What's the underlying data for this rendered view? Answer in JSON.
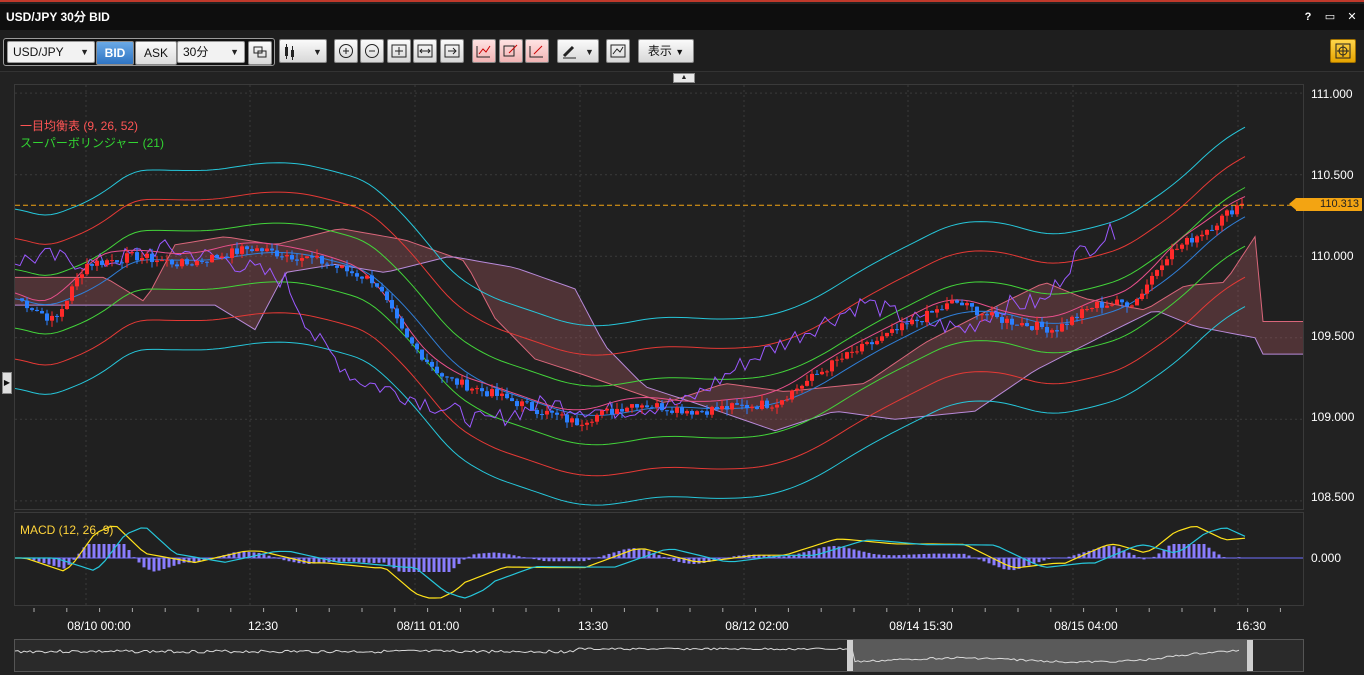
{
  "window": {
    "title": "USD/JPY 30分 BID",
    "controls": [
      "?",
      "▭",
      "✕"
    ]
  },
  "toolbar": {
    "symbol": "USD/JPY",
    "bid_label": "BID",
    "ask_label": "ASK",
    "timeframe": "30分",
    "display_label": "表示"
  },
  "chart": {
    "indicator_legend": [
      {
        "label": "一目均衡表 (9, 26, 52)",
        "color": "#ff5555"
      },
      {
        "label": "スーパーボリンジャー (21)",
        "color": "#32d432"
      }
    ],
    "y_ticks": [
      "111.000",
      "110.500",
      "110.000",
      "109.500",
      "109.000",
      "108.500"
    ],
    "current_price": "110.313",
    "macd_legend": "MACD (12, 26, 9)",
    "macd_zero": "0.000",
    "x_labels": [
      "08/10 00:00",
      "12:30",
      "08/11 01:00",
      "13:30",
      "08/12 02:00",
      "08/14 15:30",
      "08/15 04:00",
      "16:30"
    ]
  },
  "chart_data": {
    "type": "line",
    "title": "",
    "xlabel": "",
    "ylabel": "",
    "ylim": [
      108.45,
      111.05
    ],
    "categories": [
      "08/10 00:00",
      "12:30",
      "08/11 01:00",
      "13:30",
      "08/12 02:00",
      "08/14 15:30",
      "08/15 04:00",
      "16:30"
    ],
    "series": [
      {
        "name": "",
        "values": [
          109.85,
          110.05,
          109.4,
          109.0,
          109.05,
          109.7,
          109.65,
          110.31
        ]
      }
    ],
    "last_price": 110.313
  }
}
